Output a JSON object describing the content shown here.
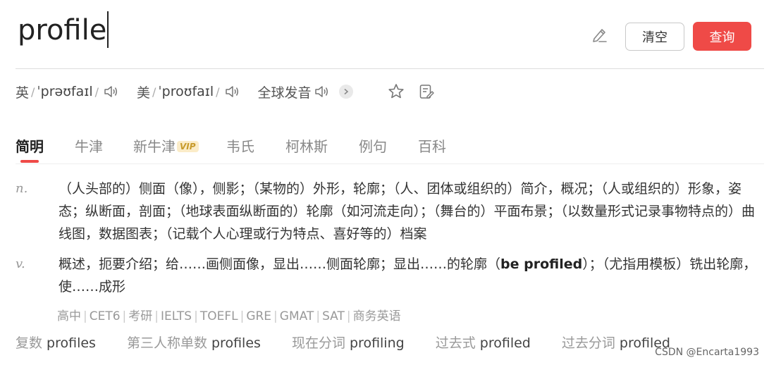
{
  "search": {
    "query": "profile",
    "clear_label": "清空",
    "search_label": "查询",
    "edit_icon": "pen-icon"
  },
  "pronunciation": {
    "uk_label": "英",
    "uk_ipa": "ˈprəʊfaɪl",
    "us_label": "美",
    "us_ipa": "ˈproʊfaɪl",
    "global_label": "全球发音",
    "speaker_icon": "speaker-icon"
  },
  "tabs": [
    {
      "label": "简明",
      "active": true
    },
    {
      "label": "牛津"
    },
    {
      "label": "新牛津",
      "badge": "VIP"
    },
    {
      "label": "韦氏"
    },
    {
      "label": "柯林斯"
    },
    {
      "label": "例句"
    },
    {
      "label": "百科"
    }
  ],
  "definitions": [
    {
      "pos": "n.",
      "text": "（人头部的）侧面（像），侧影；（某物的）外形，轮廓；（人、团体或组织的）简介，概况；（人或组织的）形象，姿态；纵断面，剖面；（地球表面纵断面的）轮廓（如河流走向）；（舞台的）平面布景；（以数量形式记录事物特点的）曲线图，数据图表；（记载个人心理或行为特点、喜好等的）档案"
    },
    {
      "pos": "v.",
      "text_before": "概述，扼要介绍；给……画侧面像，显出……侧面轮廓；显出……的轮廓（",
      "bold": "be profiled",
      "text_after": "）；（尤指用模板）铣出轮廓，使……成形"
    }
  ],
  "exams": [
    "高中",
    "CET6",
    "考研",
    "IELTS",
    "TOEFL",
    "GRE",
    "GMAT",
    "SAT",
    "商务英语"
  ],
  "forms": [
    {
      "label": "复数",
      "value": "profiles"
    },
    {
      "label": "第三人称单数",
      "value": "profiles"
    },
    {
      "label": "现在分词",
      "value": "profiling"
    },
    {
      "label": "过去式",
      "value": "profiled"
    },
    {
      "label": "过去分词",
      "value": "profiled"
    }
  ],
  "watermark": "CSDN @Encarta1993",
  "colors": {
    "accent": "#ef4a47",
    "vip_bg": "#fbecc8",
    "vip_text": "#c79a2b"
  }
}
